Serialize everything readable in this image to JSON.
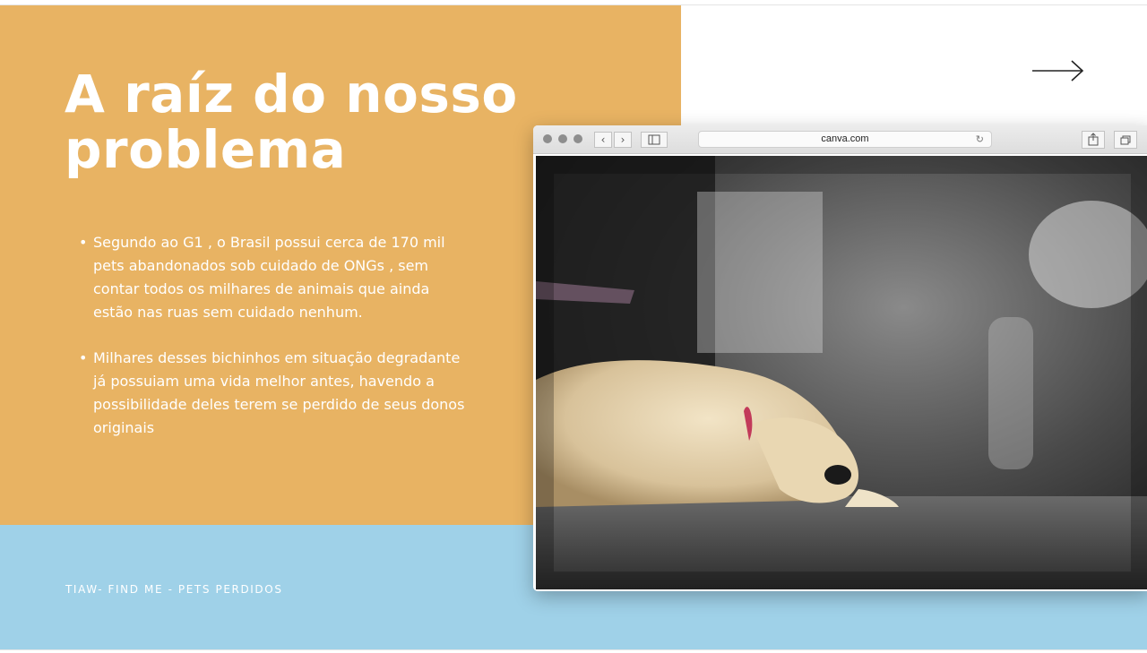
{
  "slide": {
    "title_line1": "A raíz do nosso",
    "title_line2": "problema",
    "bullets": [
      "Segundo ao G1 , o Brasil possui cerca de 170 mil pets abandonados sob cuidado de ONGs , sem contar todos os milhares de animais que ainda estão nas ruas sem cuidado nenhum.",
      " Milhares desses bichinhos em situação degradante já possuiam uma vida melhor antes, havendo a possibilidade deles terem se perdido de seus donos originais"
    ],
    "bullet_marker": "•",
    "footer": "TIAW- FIND ME - PETS PERDIDOS"
  },
  "browser": {
    "url": "canva.com",
    "back_glyph": "‹",
    "forward_glyph": "›",
    "reload_glyph": "↻"
  },
  "icons": {
    "next": "arrow-right-icon",
    "share": "share-icon",
    "tabs": "tabs-icon",
    "sidebar": "sidebar-icon"
  },
  "colors": {
    "orange_panel": "#e8b363",
    "blue_band": "#9fd1e8",
    "text_on_panel": "#ffffff"
  }
}
